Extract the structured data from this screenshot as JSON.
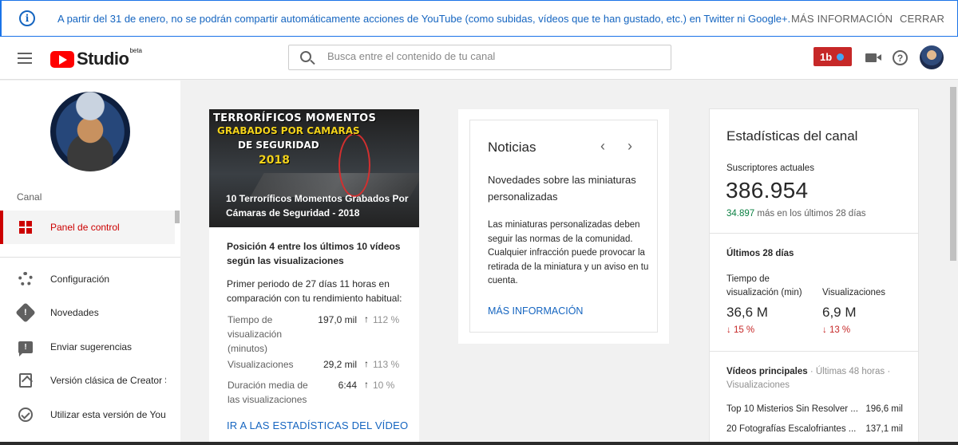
{
  "banner": {
    "message": "A partir del 31 de enero, no se podrán compartir automáticamente acciones de YouTube (como subidas, vídeos que te han gustado, etc.) en Twitter ni Google+.",
    "more_label": "MÁS INFORMACIÓN",
    "close_label": "CERRAR",
    "info_icon_glyph": "i"
  },
  "header": {
    "logo_text": "Studio",
    "logo_badge": "beta",
    "search_placeholder": "Busca entre el contenido de tu canal",
    "notification_badge": "1b",
    "help_glyph": "?"
  },
  "sidebar": {
    "section_label": "Canal",
    "items": [
      {
        "label": "Panel de control",
        "icon": "dashboard-icon",
        "active": true
      },
      {
        "label": "Configuración",
        "icon": "gear-icon"
      },
      {
        "label": "Novedades",
        "icon": "alert-icon"
      },
      {
        "label": "Enviar sugerencias",
        "icon": "feedback-icon"
      },
      {
        "label": "Versión clásica de Creator St...",
        "icon": "classic-icon"
      },
      {
        "label": "Utilizar esta versión de YouT...",
        "icon": "check-circle-icon"
      }
    ]
  },
  "video_card": {
    "thumb_line1": "TERRORÍFICOS MOMENTOS",
    "thumb_line2": "GRABADOS POR CAMARAS",
    "thumb_line3": "DE SEGURIDAD",
    "thumb_line4": "2018",
    "title": "10 Terroríficos Momentos Grabados Por Cámaras de Seguridad - 2018",
    "position_text": "Posición 4 entre los últimos 10 vídeos según las visualizaciones",
    "period_text": "Primer periodo de 27 días 11 horas en comparación con tu rendimiento habitual:",
    "rows": [
      {
        "label": "Tiempo de visualización (minutos)",
        "value": "197,0 mil",
        "pct": "112 %"
      },
      {
        "label": "Visualizaciones",
        "value": "29,2 mil",
        "pct": "113 %"
      },
      {
        "label": "Duración media de las visualizaciones",
        "value": "6:44",
        "pct": "10 %"
      }
    ],
    "arrow_glyph": "↑",
    "link_label": "IR A LAS ESTADÍSTICAS DEL VÍDEO"
  },
  "news": {
    "title": "Noticias",
    "prev_glyph": "‹",
    "next_glyph": "›",
    "headline": "Novedades sobre las miniaturas personalizadas",
    "body": "Las miniaturas personalizadas deben seguir las normas de la comunidad. Cualquier infracción puede provocar la retirada de la miniatura y un aviso en tu cuenta.",
    "link_label": "MÁS INFORMACIÓN"
  },
  "stats": {
    "title": "Estadísticas del canal",
    "subs_label": "Suscriptores actuales",
    "subs_value": "386.954",
    "subs_growth": "34.897",
    "subs_growth_suffix": "más en los últimos 28 días",
    "period_label": "Últimos 28 días",
    "watch_label": "Tiempo de visualización (min)",
    "watch_value": "36,6 M",
    "watch_delta": "↓ 15 %",
    "views_label": "Visualizaciones",
    "views_value": "6,9 M",
    "views_delta": "↓ 13 %",
    "top_title": "Vídeos principales",
    "top_sub": " · Últimas 48 horas · Visualizaciones",
    "top_videos": [
      {
        "title": "Top 10 Misterios Sin Resolver ...",
        "views": "196,6 mil"
      },
      {
        "title": "20 Fotografías Escalofriantes ...",
        "views": "137,1 mil"
      }
    ]
  },
  "colors": {
    "accent": "#cc0000",
    "link": "#1565c0",
    "positive": "#0b8043",
    "negative": "#c62828"
  }
}
